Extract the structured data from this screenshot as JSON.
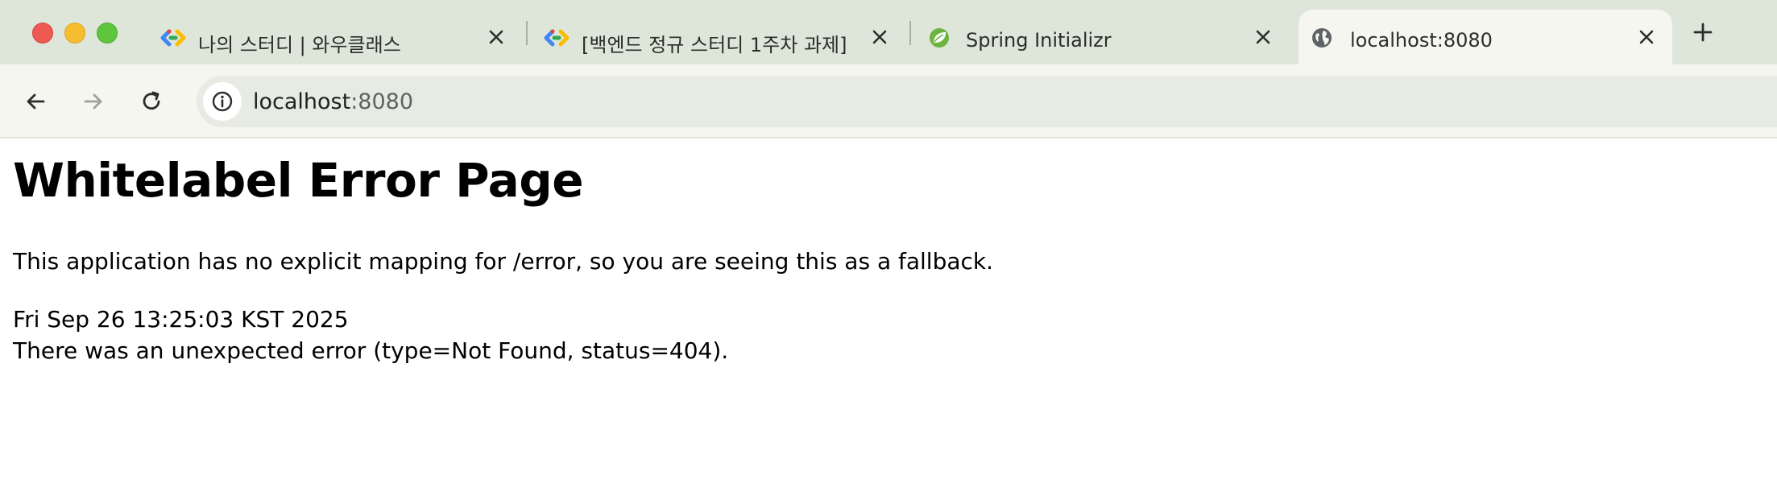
{
  "tabs": [
    {
      "title": "나의 스터디 | 와우클래스",
      "favicon": "google-cloud-logo-icon",
      "active": false
    },
    {
      "title": "[백엔드 정규 스터디 1주차 과제]",
      "favicon": "google-cloud-logo-icon",
      "active": false
    },
    {
      "title": "Spring Initializr",
      "favicon": "spring-leaf-icon",
      "active": false
    },
    {
      "title": "localhost:8080",
      "favicon": "globe-icon",
      "active": true
    }
  ],
  "toolbar": {
    "url_host": "localhost",
    "url_port": ":8080",
    "icons": [
      "back-arrow-icon",
      "forward-arrow-icon",
      "reload-icon",
      "info-icon"
    ]
  },
  "page": {
    "heading": "Whitelabel Error Page",
    "message": "This application has no explicit mapping for /error, so you are seeing this as a fallback.",
    "timestamp": "Fri Sep 26 13:25:03 KST 2025",
    "error": "There was an unexpected error (type=Not Found, status=404)."
  },
  "colors": {
    "tabstrip": "#dee6da",
    "active_tab": "#f6f6f1",
    "omnibox": "#e8eae4",
    "spring_green": "#6db33f"
  }
}
